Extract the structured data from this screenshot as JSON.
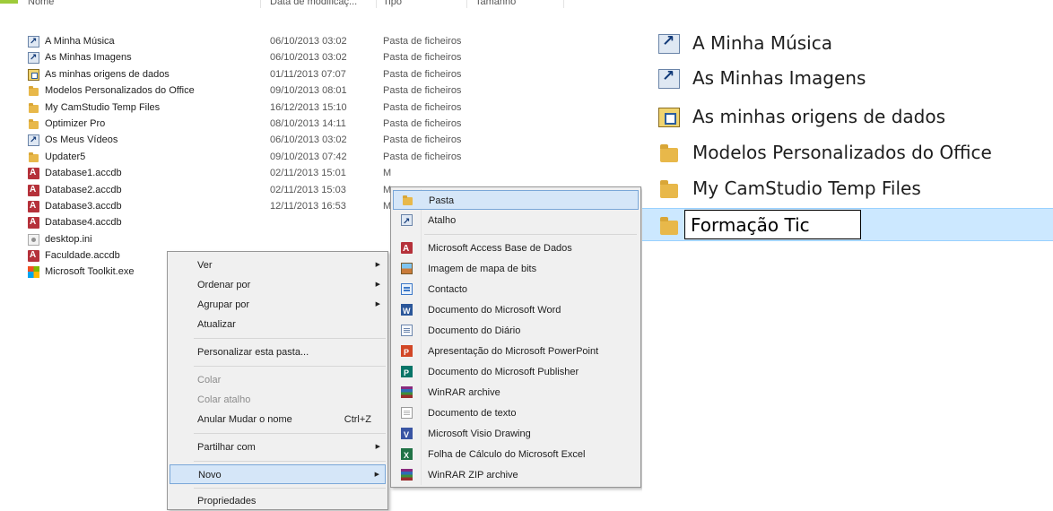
{
  "columns": {
    "name": "Nome",
    "date": "Data de modificaç...",
    "type": "Tipo",
    "size": "Tamanho"
  },
  "files": [
    {
      "icon": "shortcut-icon",
      "name": "A Minha Música",
      "date": "06/10/2013 03:02",
      "type": "Pasta de ficheiros"
    },
    {
      "icon": "shortcut-icon",
      "name": "As Minhas Imagens",
      "date": "06/10/2013 03:02",
      "type": "Pasta de ficheiros"
    },
    {
      "icon": "datasource-folder-icon",
      "name": "As minhas origens de dados",
      "date": "01/11/2013 07:07",
      "type": "Pasta de ficheiros"
    },
    {
      "icon": "folder-icon",
      "name": "Modelos Personalizados do Office",
      "date": "09/10/2013 08:01",
      "type": "Pasta de ficheiros"
    },
    {
      "icon": "folder-icon",
      "name": "My CamStudio Temp Files",
      "date": "16/12/2013 15:10",
      "type": "Pasta de ficheiros"
    },
    {
      "icon": "folder-icon",
      "name": "Optimizer Pro",
      "date": "08/10/2013 14:11",
      "type": "Pasta de ficheiros"
    },
    {
      "icon": "shortcut-icon",
      "name": "Os Meus Vídeos",
      "date": "06/10/2013 03:02",
      "type": "Pasta de ficheiros"
    },
    {
      "icon": "folder-icon",
      "name": "Updater5",
      "date": "09/10/2013 07:42",
      "type": "Pasta de ficheiros"
    },
    {
      "icon": "access-icon",
      "name": "Database1.accdb",
      "date": "02/11/2013 15:01",
      "type": "M"
    },
    {
      "icon": "access-icon",
      "name": "Database2.accdb",
      "date": "02/11/2013 15:03",
      "type": "M"
    },
    {
      "icon": "access-icon",
      "name": "Database3.accdb",
      "date": "12/11/2013 16:53",
      "type": "M"
    },
    {
      "icon": "access-icon",
      "name": "Database4.accdb",
      "date": "",
      "type": ""
    },
    {
      "icon": "ini-file-icon",
      "name": "desktop.ini",
      "date": "",
      "type": ""
    },
    {
      "icon": "access-icon",
      "name": "Faculdade.accdb",
      "date": "",
      "type": ""
    },
    {
      "icon": "exe-icon",
      "name": "Microsoft Toolkit.exe",
      "date": "",
      "type": ""
    }
  ],
  "context_menu": {
    "ver": "Ver",
    "ordenar": "Ordenar por",
    "agrupar": "Agrupar por",
    "atualizar": "Atualizar",
    "personalizar": "Personalizar esta pasta...",
    "colar": "Colar",
    "colar_atalho": "Colar atalho",
    "anular": "Anular Mudar o nome",
    "anular_shortcut": "Ctrl+Z",
    "partilhar": "Partilhar com",
    "novo": "Novo",
    "propriedades": "Propriedades"
  },
  "new_submenu": [
    {
      "icon": "folder-icon",
      "label": "Pasta"
    },
    {
      "icon": "shortcut-icon",
      "label": "Atalho"
    },
    {
      "icon": "access-icon",
      "label": "Microsoft Access Base de Dados"
    },
    {
      "icon": "bitmap-icon",
      "label": "Imagem de mapa de bits"
    },
    {
      "icon": "contact-icon",
      "label": "Contacto"
    },
    {
      "icon": "word-icon",
      "label": "Documento do Microsoft Word"
    },
    {
      "icon": "journal-icon",
      "label": "Documento do Diário"
    },
    {
      "icon": "powerpoint-icon",
      "label": "Apresentação do Microsoft PowerPoint"
    },
    {
      "icon": "publisher-icon",
      "label": "Documento do Microsoft Publisher"
    },
    {
      "icon": "winrar-icon",
      "label": "WinRAR archive"
    },
    {
      "icon": "text-file-icon",
      "label": "Documento de texto"
    },
    {
      "icon": "visio-icon",
      "label": "Microsoft Visio Drawing"
    },
    {
      "icon": "excel-icon",
      "label": "Folha de Cálculo do Microsoft Excel"
    },
    {
      "icon": "winrar-zip-icon",
      "label": "WinRAR ZIP archive"
    }
  ],
  "zoom_panel": {
    "items": [
      {
        "icon": "shortcut-icon",
        "name": "A Minha Música"
      },
      {
        "icon": "shortcut-icon",
        "name": "As Minhas Imagens"
      },
      {
        "icon": "datasource-folder-icon",
        "name": "As minhas origens de dados"
      },
      {
        "icon": "folder-icon",
        "name": "Modelos Personalizados do Office"
      },
      {
        "icon": "folder-icon",
        "name": "My CamStudio Temp Files"
      }
    ],
    "rename_value": "Formação Tic"
  },
  "colors": {
    "accent": "#9ecb3a",
    "highlight": "#d5e6f8",
    "selection": "#cce8ff",
    "folder": "#e8b84a"
  }
}
